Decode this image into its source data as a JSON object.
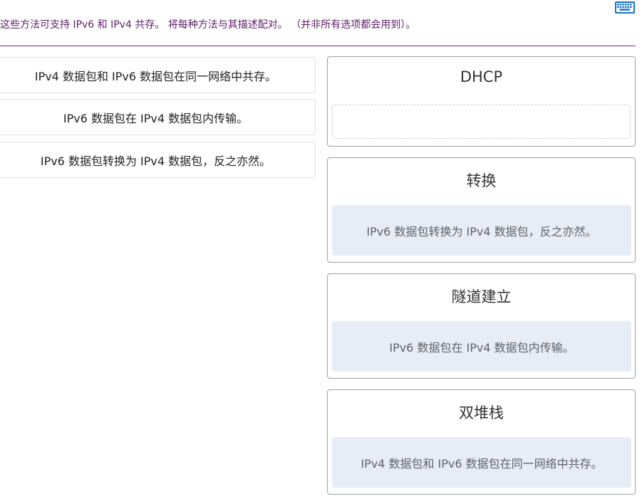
{
  "toolbar": {
    "keyboard_icon": "keyboard-icon"
  },
  "instruction": "这些方法可支持 IPv6 和 IPv4 共存。 将每种方法与其描述配对。 （并非所有选项都会用到）。",
  "source_items": [
    "IPv4 数据包和 IPv6 数据包在同一网络中共存。",
    "IPv6 数据包在 IPv4 数据包内传输。",
    "IPv6 数据包转换为 IPv4 数据包，反之亦然。"
  ],
  "targets": [
    {
      "title": "DHCP",
      "placed": ""
    },
    {
      "title": "转换",
      "placed": "IPv6 数据包转换为 IPv4 数据包，反之亦然。"
    },
    {
      "title": "隧道建立",
      "placed": "IPv6 数据包在 IPv4 数据包内传输。"
    },
    {
      "title": "双堆栈",
      "placed": "IPv4 数据包和 IPv6 数据包在同一网络中共存。"
    }
  ],
  "colors": {
    "instruction": "#5f1d6b",
    "divider": "#7a2a86",
    "placed_bg": "#e6edf7",
    "keyboard_icon": "#1a73c9"
  }
}
